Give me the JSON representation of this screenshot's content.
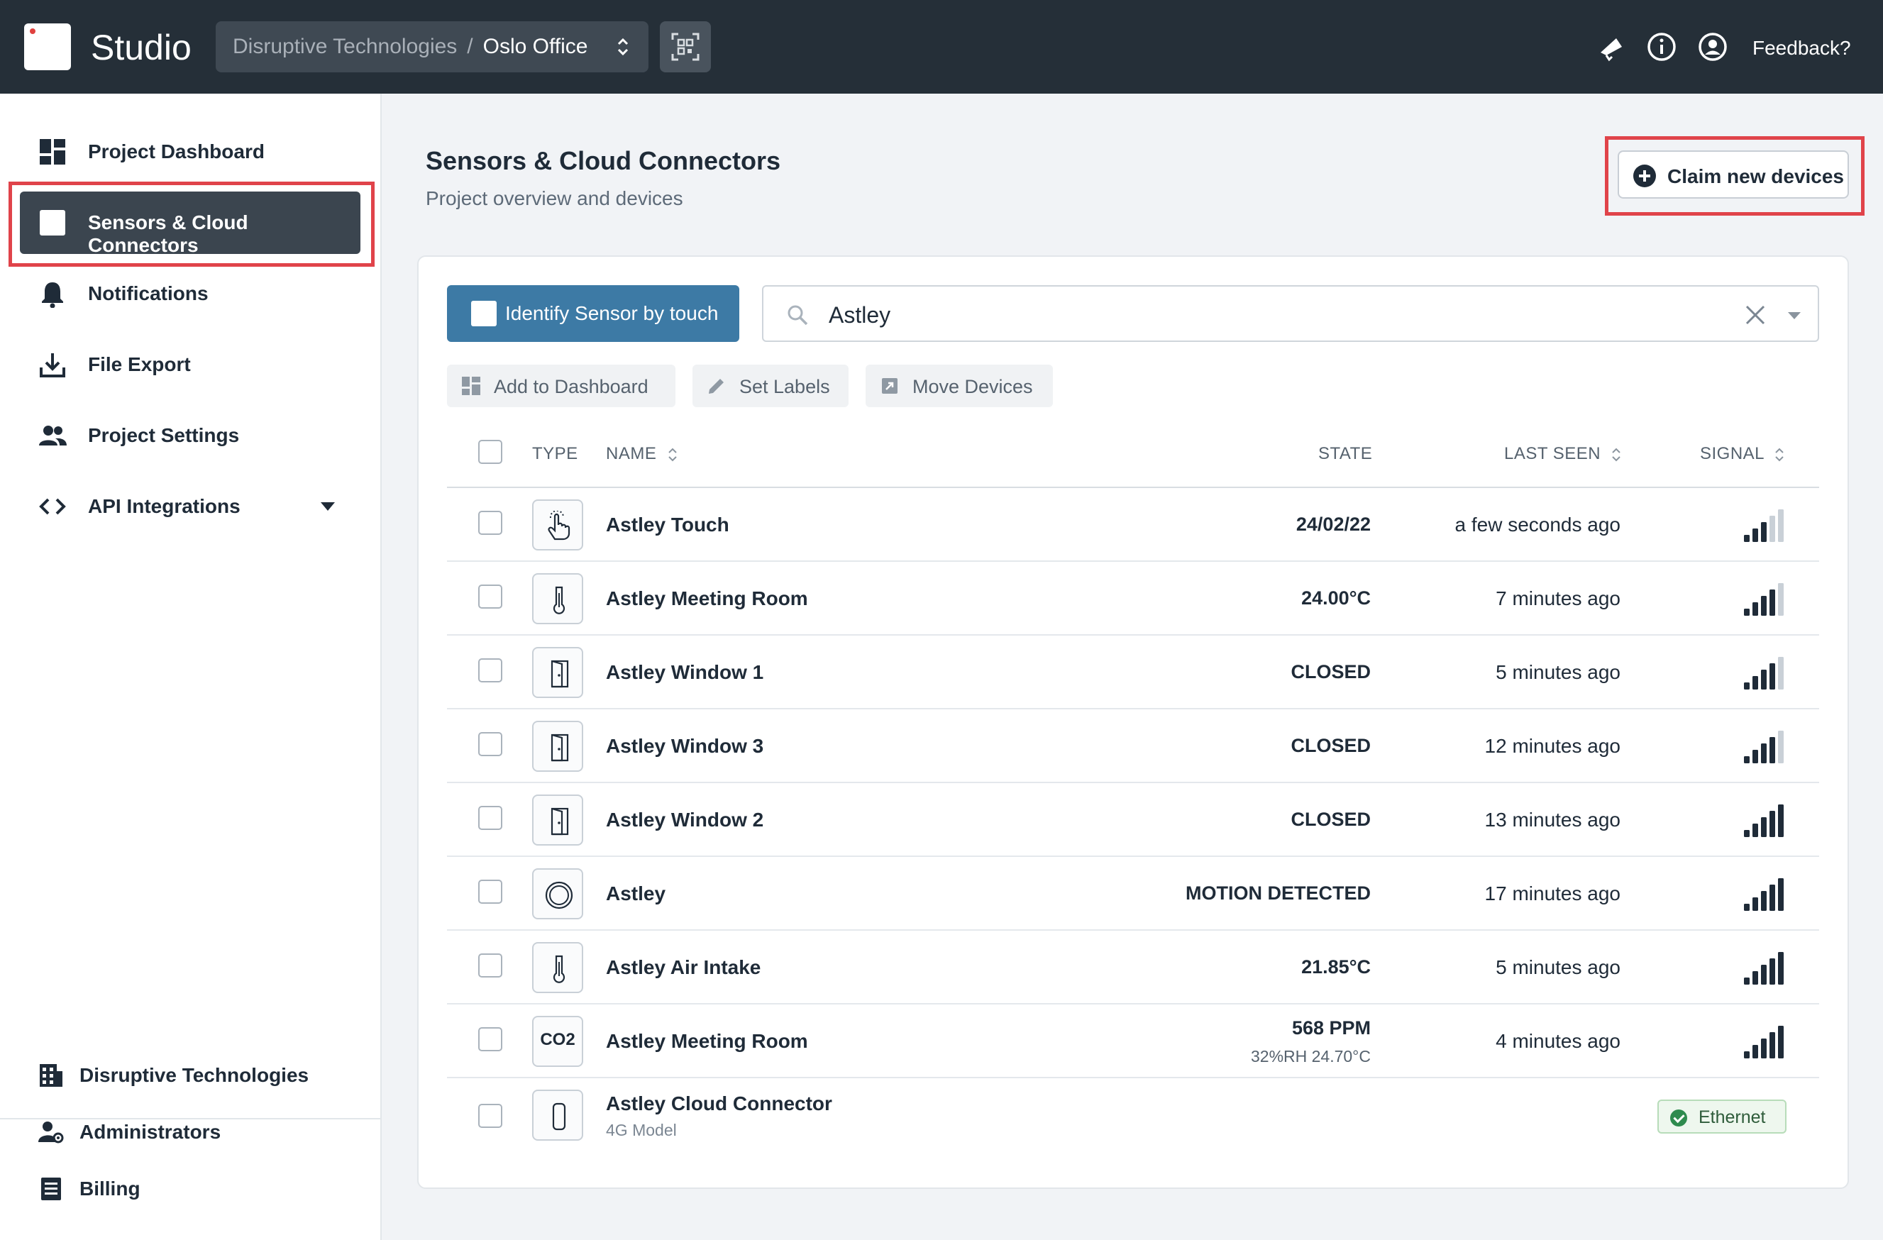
{
  "topbar": {
    "app_title": "Studio",
    "organization": "Disruptive Technologies",
    "separator": "/",
    "project": "Oslo Office",
    "feedback_label": "Feedback?"
  },
  "sidebar": {
    "items": [
      {
        "label": "Project Dashboard",
        "icon": "dashboard-icon"
      },
      {
        "label": "Sensors & Cloud Connectors",
        "icon": "sensor-icon",
        "active": true
      },
      {
        "label": "Notifications",
        "icon": "bell-icon"
      },
      {
        "label": "File Export",
        "icon": "download-icon"
      },
      {
        "label": "Project Settings",
        "icon": "people-icon"
      },
      {
        "label": "API Integrations",
        "icon": "code-icon"
      }
    ],
    "org_items": [
      {
        "label": "Disruptive Technologies",
        "icon": "building-icon"
      },
      {
        "label": "Administrators",
        "icon": "admin-icon"
      },
      {
        "label": "Billing",
        "icon": "billing-icon"
      }
    ]
  },
  "main": {
    "title": "Sensors & Cloud Connectors",
    "subtitle": "Project overview and devices",
    "claim_label": "Claim new devices",
    "identify_label": "Identify Sensor by touch",
    "search_value": "Astley",
    "actions": {
      "add_dashboard": "Add to Dashboard",
      "set_labels": "Set Labels",
      "move_devices": "Move Devices"
    },
    "columns": {
      "type": "TYPE",
      "name": "NAME",
      "state": "STATE",
      "last_seen": "LAST SEEN",
      "signal": "SIGNAL"
    },
    "rows": [
      {
        "type": "touch",
        "name": "Astley Touch",
        "state": "24/02/22",
        "last_seen": "a few seconds ago",
        "signal": 3
      },
      {
        "type": "temperature",
        "name": "Astley Meeting Room",
        "state": "24.00°C",
        "last_seen": "7 minutes ago",
        "signal": 4
      },
      {
        "type": "proximity",
        "name": "Astley Window 1",
        "state": "CLOSED",
        "last_seen": "5 minutes ago",
        "signal": 4
      },
      {
        "type": "proximity",
        "name": "Astley Window 3",
        "state": "CLOSED",
        "last_seen": "12 minutes ago",
        "signal": 4
      },
      {
        "type": "proximity",
        "name": "Astley Window 2",
        "state": "CLOSED",
        "last_seen": "13 minutes ago",
        "signal": 5
      },
      {
        "type": "motion",
        "name": "Astley",
        "state": "MOTION DETECTED",
        "last_seen": "17 minutes ago",
        "signal": 5
      },
      {
        "type": "temperature",
        "name": "Astley Air Intake",
        "state": "21.85°C",
        "last_seen": "5 minutes ago",
        "signal": 5
      },
      {
        "type": "co2",
        "type_label": "CO2",
        "name": "Astley Meeting Room",
        "state": "568 PPM",
        "state_sub": "32%RH 24.70°C",
        "last_seen": "4 minutes ago",
        "signal": 5
      },
      {
        "type": "cloud-connector",
        "name": "Astley Cloud Connector",
        "subname": "4G Model",
        "connection": "Ethernet"
      }
    ]
  },
  "colors": {
    "topbar": "#252f38",
    "active_nav": "#3b454f",
    "primary_button": "#3d7aa5",
    "highlight": "#e0434a",
    "ethernet_ok": "#2e8b4e"
  }
}
